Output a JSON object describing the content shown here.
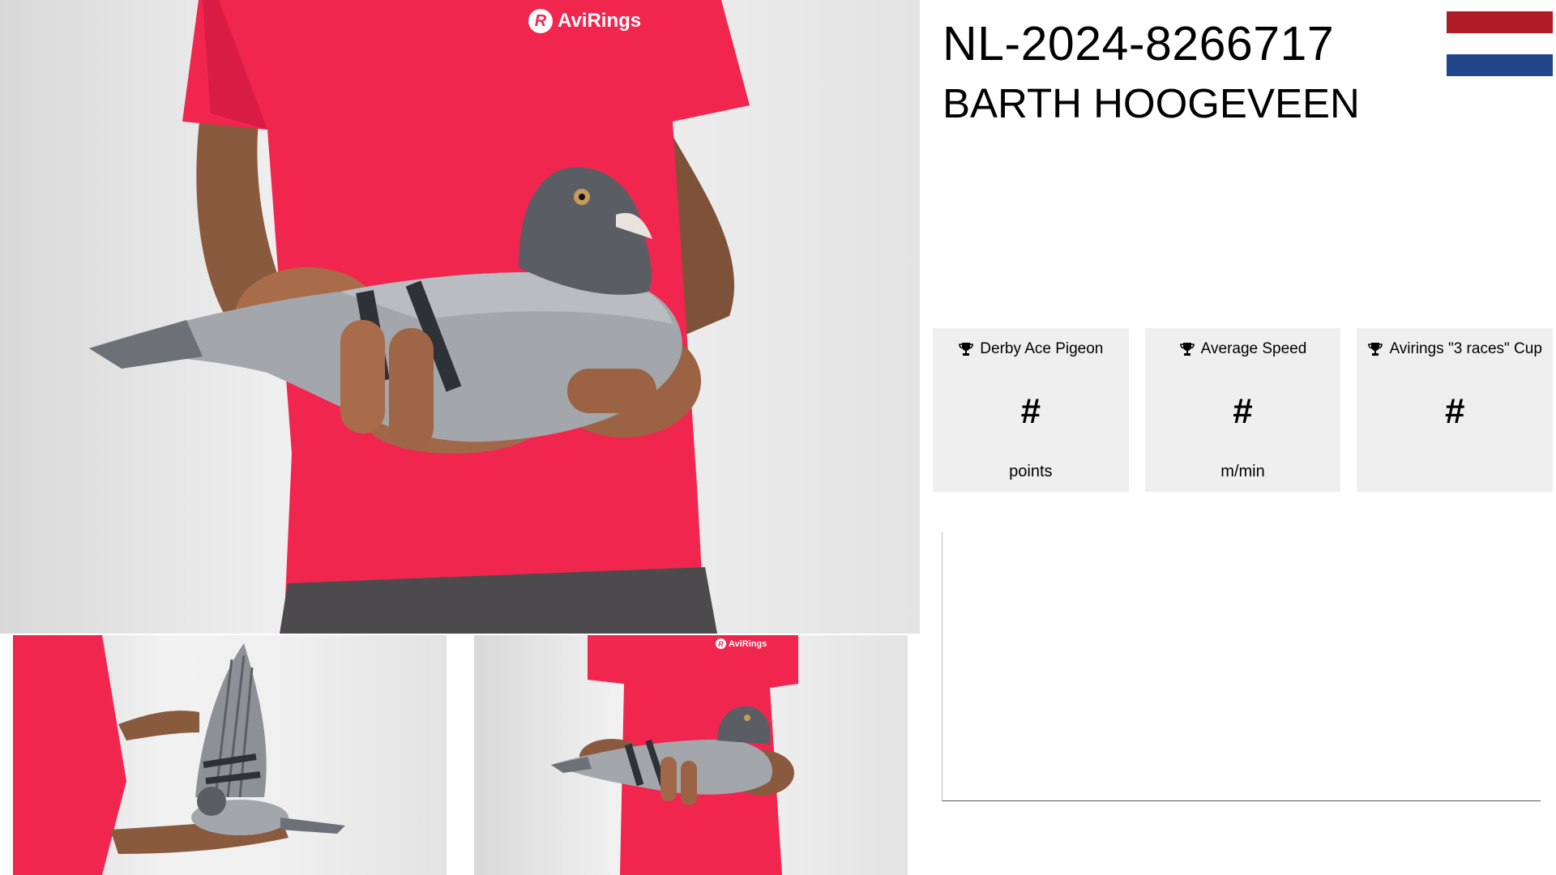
{
  "pigeon": {
    "ring_number": "NL-2024-8266717",
    "owner": "BARTH HOOGEVEEN"
  },
  "country_flag": {
    "icon": "netherlands-flag-icon",
    "colors": [
      "#ae1c28",
      "#ffffff",
      "#21468b"
    ]
  },
  "photos": {
    "main_alt": "Pigeon held in hands",
    "wing_alt": "Pigeon wing spread",
    "side_alt": "Pigeon held in hands, smaller view",
    "shirt_brand": "AviRings",
    "shirt_brand_mark": "R",
    "shirt_color": "#f0264f"
  },
  "stats": [
    {
      "icon": "trophy-icon",
      "title": "Derby Ace Pigeon",
      "value": "#",
      "unit": "points"
    },
    {
      "icon": "trophy-icon",
      "title": "Average Speed",
      "value": "#",
      "unit": "m/min"
    },
    {
      "icon": "trophy-icon",
      "title": "Avirings \"3 races\" Cup",
      "value": "#",
      "unit": ""
    }
  ],
  "colors": {
    "card_background": "#efefef",
    "text": "#000000"
  }
}
